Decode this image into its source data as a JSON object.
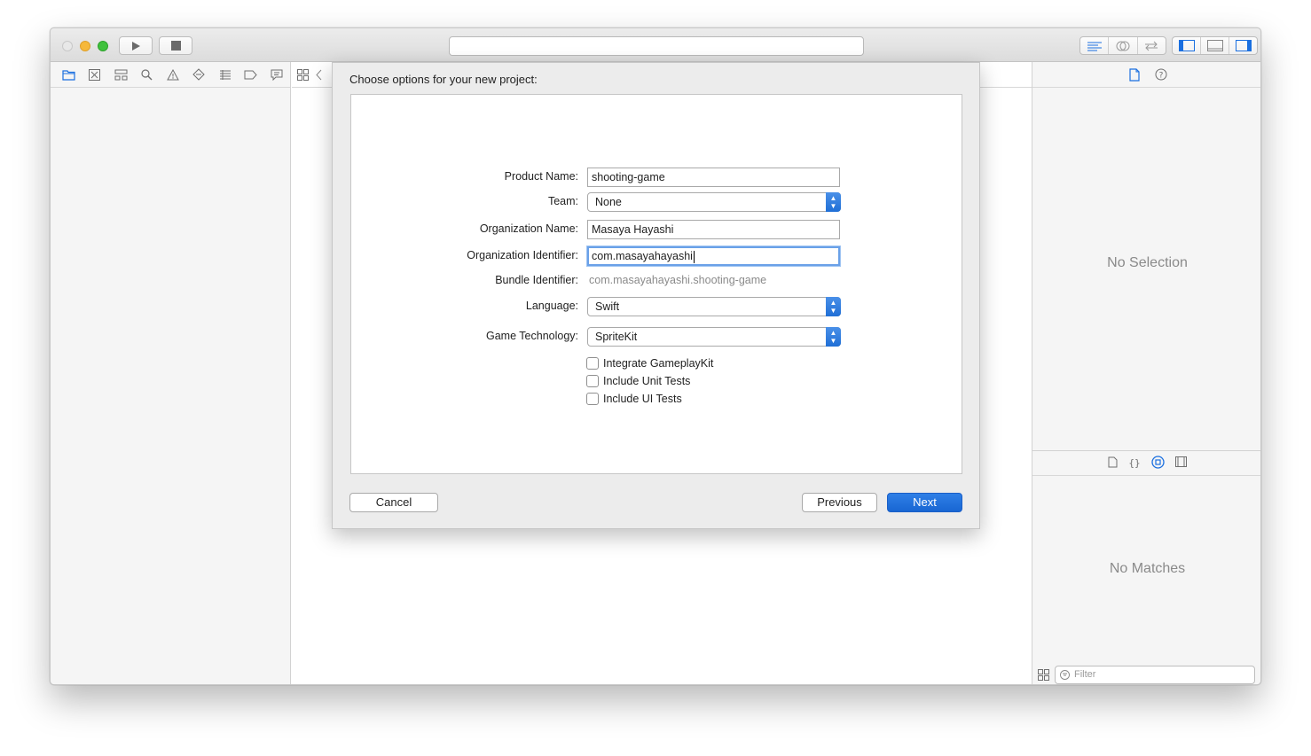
{
  "toolbar": {
    "run_icon": "play-icon",
    "stop_icon": "stop-icon",
    "activity_text": ""
  },
  "navigator": {
    "icons": [
      "folder-icon",
      "source-control-icon",
      "symbol-icon",
      "search-icon",
      "warning-icon",
      "test-icon",
      "debug-icon",
      "breakpoint-icon",
      "report-icon"
    ]
  },
  "inspector": {
    "no_selection": "No Selection",
    "no_matches": "No Matches",
    "filter_placeholder": "Filter"
  },
  "sheet": {
    "title": "Choose options for your new project:",
    "fields": {
      "product_name_label": "Product Name:",
      "product_name_value": "shooting-game",
      "team_label": "Team:",
      "team_value": "None",
      "org_name_label": "Organization Name:",
      "org_name_value": "Masaya Hayashi",
      "org_id_label": "Organization Identifier:",
      "org_id_value": "com.masayahayashi",
      "bundle_id_label": "Bundle Identifier:",
      "bundle_id_value": "com.masayahayashi.shooting-game",
      "language_label": "Language:",
      "language_value": "Swift",
      "game_tech_label": "Game Technology:",
      "game_tech_value": "SpriteKit"
    },
    "checkboxes": {
      "gameplaykit": "Integrate GameplayKit",
      "unit_tests": "Include Unit Tests",
      "ui_tests": "Include UI Tests"
    },
    "buttons": {
      "cancel": "Cancel",
      "previous": "Previous",
      "next": "Next"
    }
  },
  "colors": {
    "accent": "#1a6fe0",
    "default_button": "#1866d3"
  }
}
